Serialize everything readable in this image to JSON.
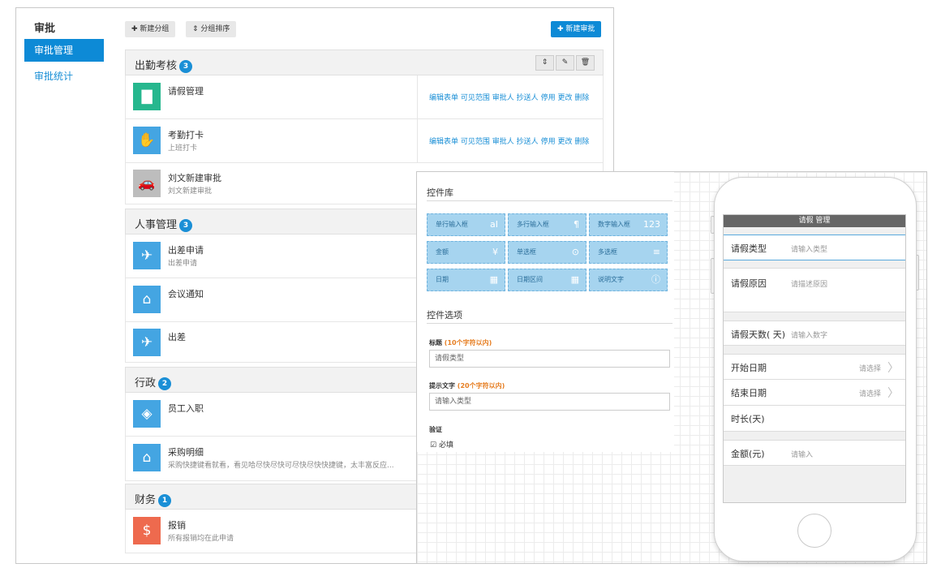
{
  "sidebar": {
    "title": "审批",
    "items": [
      "审批管理",
      "审批统计"
    ]
  },
  "toolbar": {
    "new_group": "新建分组",
    "sort_group": "分组排序",
    "new_approval": "新建审批"
  },
  "groups": [
    {
      "name": "出勤考核",
      "count": "3"
    },
    {
      "name": "人事管理",
      "count": "3"
    },
    {
      "name": "行政",
      "count": "2"
    },
    {
      "name": "财务",
      "count": "1"
    }
  ],
  "rows": [
    {
      "name": "请假管理",
      "desc": "",
      "icon": "chat-icon",
      "color": "#26b78e"
    },
    {
      "name": "考勤打卡",
      "desc": "上班打卡",
      "icon": "handshake-icon",
      "color": "#44a5e2"
    },
    {
      "name": "刘文新建审批",
      "desc": "刘文新建审批",
      "icon": "car-icon",
      "color": "#bdbdbd"
    },
    {
      "name": "出差申请",
      "desc": "出差申请",
      "icon": "plane-icon",
      "color": "#44a5e2"
    },
    {
      "name": "会议通知",
      "desc": "",
      "icon": "store-icon",
      "color": "#44a5e2"
    },
    {
      "name": "出差",
      "desc": "",
      "icon": "plane-icon",
      "color": "#44a5e2"
    },
    {
      "name": "员工入职",
      "desc": "",
      "icon": "tag-icon",
      "color": "#44a5e2"
    },
    {
      "name": "采购明细",
      "desc": "采购快捷键看就看，看见哈尽快尽快可尽快尽快快捷键，太丰富反应...",
      "icon": "store-icon",
      "color": "#44a5e2"
    },
    {
      "name": "报销",
      "desc": "所有报销均在此申请",
      "icon": "money-bag-icon",
      "color": "#ee6a4e"
    }
  ],
  "row_actions": [
    "编辑表单",
    "可见范围",
    "审批人",
    "抄送人",
    "停用",
    "更改",
    "删除"
  ],
  "designer": {
    "library_title": "控件库",
    "controls": [
      {
        "label": "单行输入框",
        "icon": "aI"
      },
      {
        "label": "多行输入框",
        "icon": "¶"
      },
      {
        "label": "数字输入框",
        "icon": "123"
      },
      {
        "label": "金额",
        "icon": "¥"
      },
      {
        "label": "单选框",
        "icon": "⊙"
      },
      {
        "label": "多选框",
        "icon": "≡"
      },
      {
        "label": "日期",
        "icon": "▦"
      },
      {
        "label": "日期区间",
        "icon": "▦"
      },
      {
        "label": "说明文字",
        "icon": "ⓘ"
      }
    ],
    "options_title": "控件选项",
    "title_label": "标题",
    "title_hint": "(10个字符以内)",
    "title_value": "请假类型",
    "prompt_label": "提示文字",
    "prompt_hint": "(20个字符以内)",
    "prompt_value": "请输入类型",
    "verify_label": "验证",
    "required_label": "必填"
  },
  "phone": {
    "header": "请假 管理",
    "fields": [
      {
        "label": "请假类型",
        "placeholder": "请输入类型"
      },
      {
        "label": "请假原因",
        "placeholder": "请描述原因"
      },
      {
        "label": "请假天数( 天)",
        "placeholder": "请输入数字"
      },
      {
        "label": "开始日期",
        "placeholder": "请选择"
      },
      {
        "label": "结束日期",
        "placeholder": "请选择"
      },
      {
        "label": "时长(天)",
        "placeholder": ""
      },
      {
        "label": "金额(元)",
        "placeholder": "请输入"
      }
    ]
  }
}
